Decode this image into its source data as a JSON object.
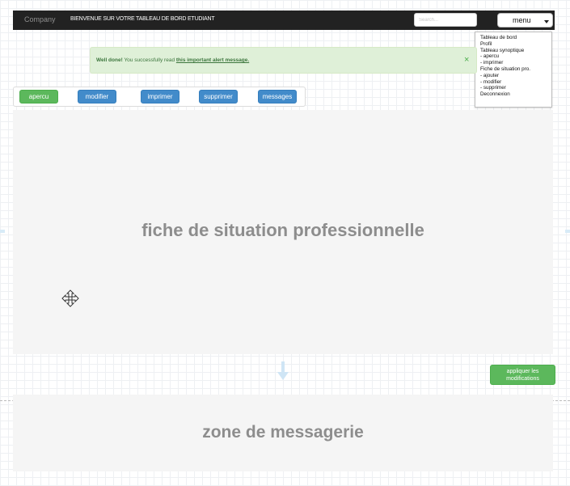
{
  "navbar": {
    "brand": "Company",
    "welcome": "BIENVENUE SUR VOTRE TABLEAU DE BORD ETUDIANT",
    "search_placeholder": "Search...",
    "menu_label": "menu"
  },
  "dropdown": {
    "items": [
      "Tableau de bord",
      "Profil",
      "Tableau synoptique",
      "- apercu",
      "- imprimer",
      "Fiche de situation pro.",
      "- ajouter",
      "- modifier",
      "- supprimer",
      "Deconnexion"
    ]
  },
  "alert": {
    "strong": "Well done!",
    "text": " You successfully read ",
    "link": "this important alert message.",
    "close": "×"
  },
  "actions": {
    "apercu": "apercu",
    "modifier": "modifier",
    "imprimer": "imprimer",
    "supprimer": "supprimer",
    "messages": "messages"
  },
  "fiche": {
    "title": "fiche de situation professionnelle"
  },
  "apply": {
    "label": "appliquer les modifications"
  },
  "messagerie": {
    "title": "zone de messagerie"
  },
  "colors": {
    "navbar": "#222222",
    "alert_bg": "#dff0d8",
    "alert_text": "#3c763d",
    "btn_green": "#5cb85c",
    "btn_blue": "#428bca",
    "panel_bg": "#f5f5f5",
    "panel_title": "#8d8d8d"
  },
  "icons": {
    "move": "move-arrows-icon",
    "arrow_down": "arrow-down-icon",
    "caret": "caret-down-icon",
    "close": "close-icon"
  }
}
